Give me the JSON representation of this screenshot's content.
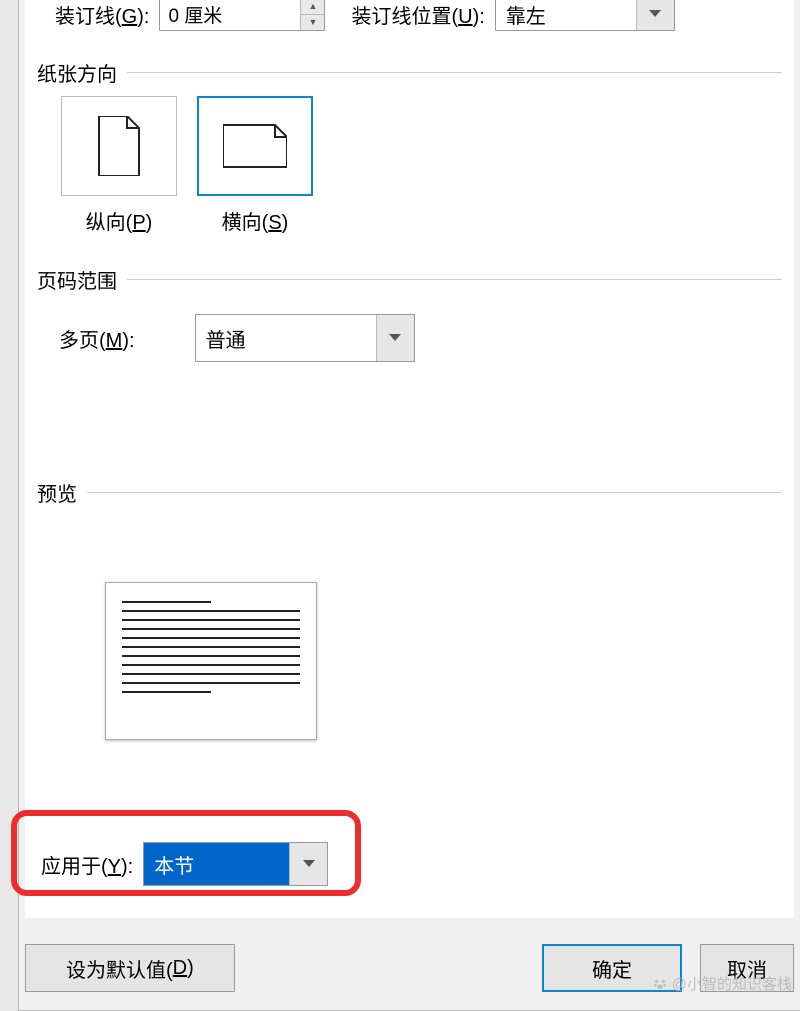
{
  "top": {
    "gutter_label_pre": "装订线(",
    "gutter_key": "G",
    "gutter_label_post": "):",
    "gutter_value": "0 厘米",
    "gutter_pos_label_pre": "装订线位置(",
    "gutter_pos_key": "U",
    "gutter_pos_label_post": "):",
    "gutter_pos_value": "靠左"
  },
  "sections": {
    "orientation_title": "纸张方向",
    "page_range_title": "页码范围",
    "preview_title": "预览"
  },
  "orientation": {
    "portrait_label_pre": "纵向(",
    "portrait_key": "P",
    "portrait_label_post": ")",
    "landscape_label_pre": "横向(",
    "landscape_key": "S",
    "landscape_label_post": ")"
  },
  "page_range": {
    "multi_label_pre": "多页(",
    "multi_key": "M",
    "multi_label_post": "):",
    "multi_value": "普通"
  },
  "apply": {
    "label_pre": "应用于(",
    "key": "Y",
    "label_post": "):",
    "value": "本节"
  },
  "buttons": {
    "default_pre": "设为默认值(",
    "default_key": "D",
    "default_post": ")",
    "ok": "确定",
    "cancel": "取消"
  },
  "watermark": "@小智的知识客栈"
}
